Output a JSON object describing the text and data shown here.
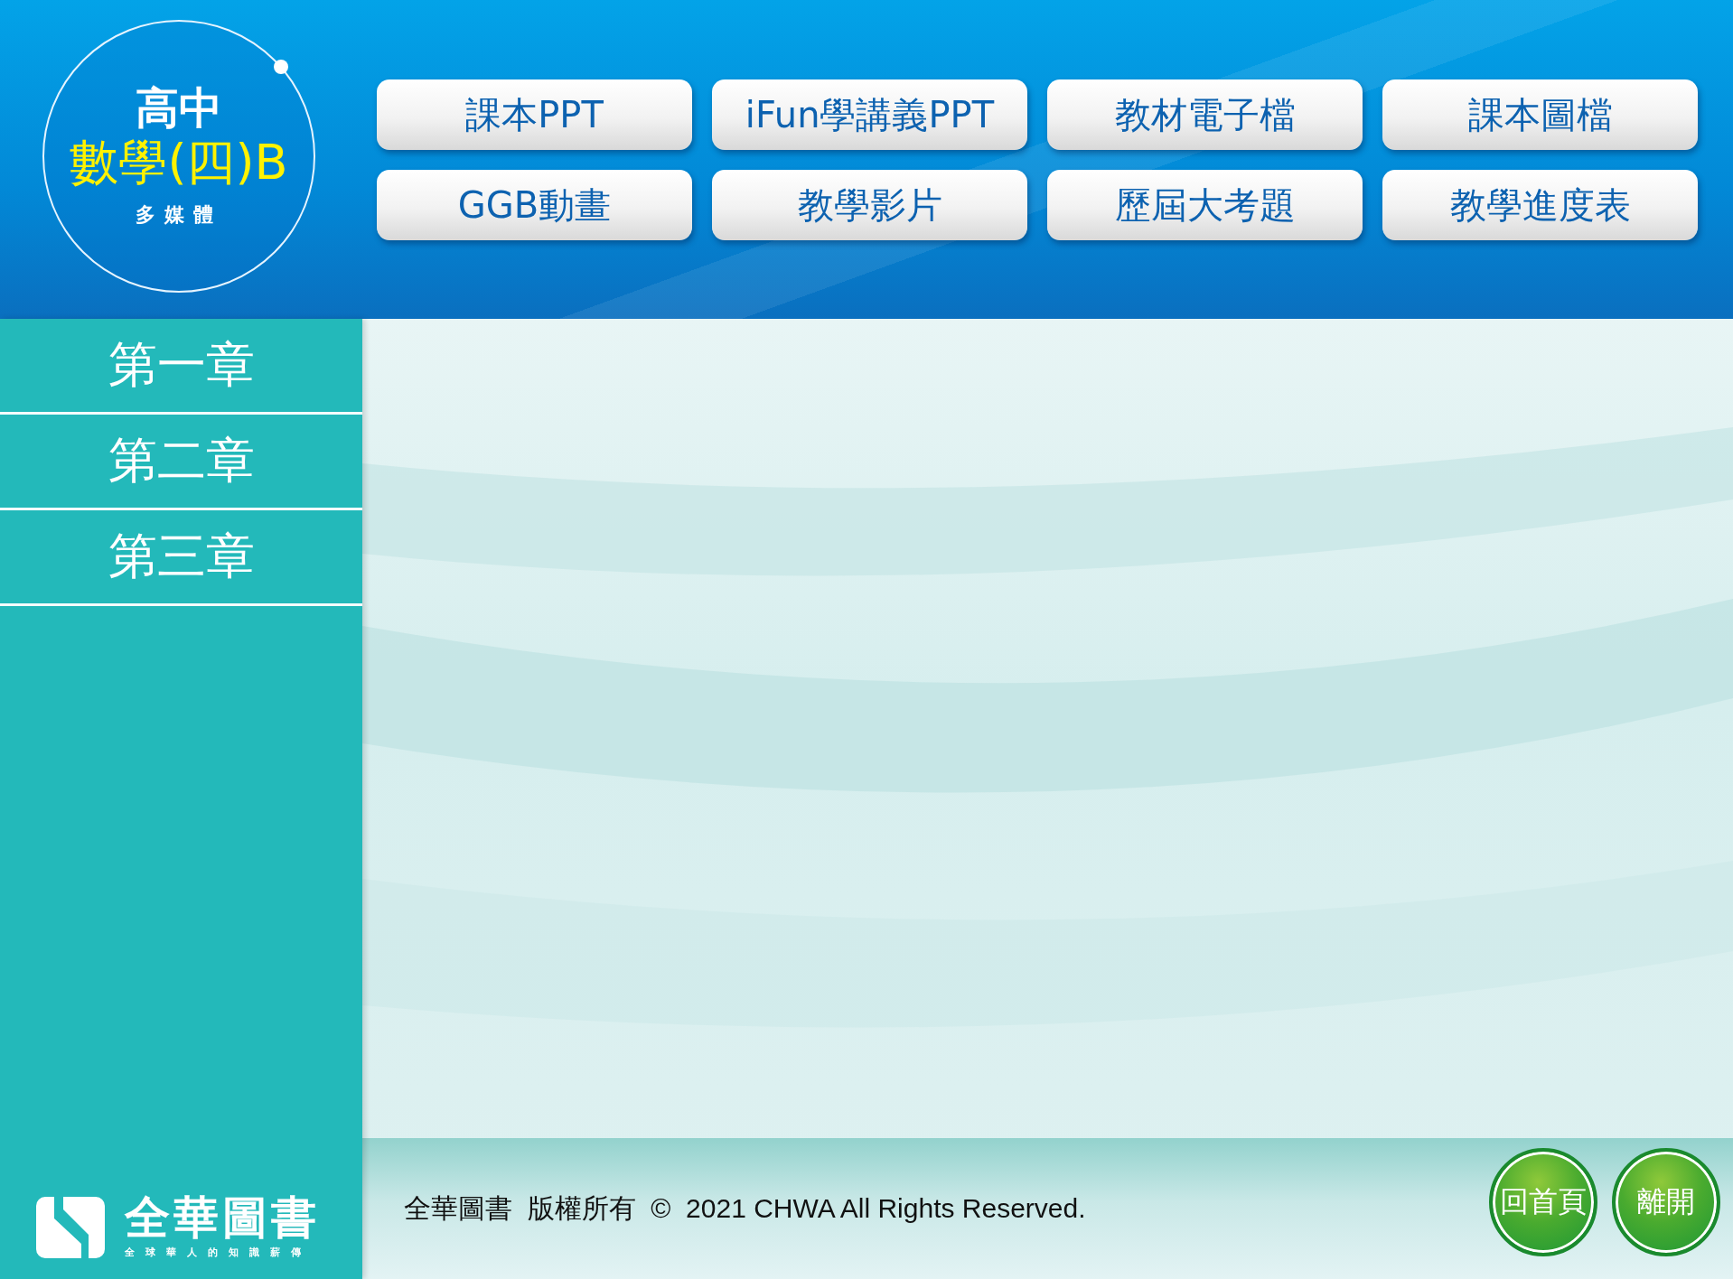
{
  "logo": {
    "level_name": "高中",
    "subject": "數學(四)B",
    "subtitle": "多媒體"
  },
  "nav_buttons": [
    {
      "label": "課本PPT"
    },
    {
      "label": "iFun學講義PPT"
    },
    {
      "label": "教材電子檔"
    },
    {
      "label": "課本圖檔"
    },
    {
      "label": "GGB動畫"
    },
    {
      "label": "教學影片"
    },
    {
      "label": "歷屆大考題"
    },
    {
      "label": "教學進度表"
    }
  ],
  "chapters": [
    {
      "label": "第一章"
    },
    {
      "label": "第二章"
    },
    {
      "label": "第三章"
    }
  ],
  "publisher": {
    "name": "全華圖書",
    "tagline": "全球華人的知識薪傳"
  },
  "footer": {
    "copyright": "全華圖書  版權所有  ©  2021 CHWA All Rights Reserved."
  },
  "bottom_buttons": [
    {
      "label": "回首頁"
    },
    {
      "label": "離開"
    }
  ]
}
